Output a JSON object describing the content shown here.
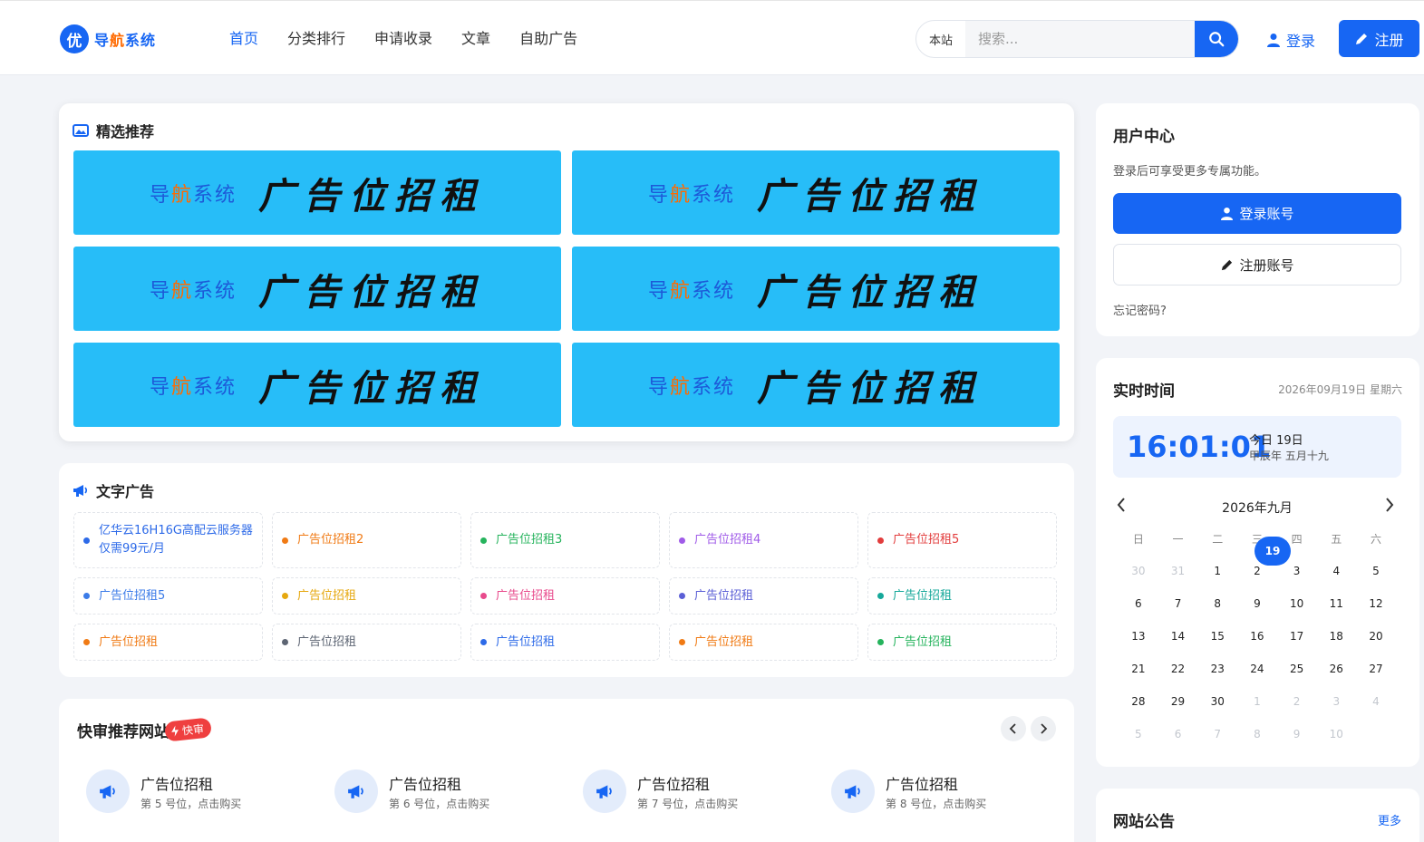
{
  "header": {
    "logo_badge": "优",
    "logo_text_a": "导",
    "logo_text_b": "航",
    "logo_text_c": "系统",
    "nav": [
      "首页",
      "分类排行",
      "申请收录",
      "文章",
      "自助广告"
    ],
    "search_scope": "本站",
    "search_placeholder": "搜索...",
    "login_label": "登录",
    "register_label": "注册"
  },
  "featured": {
    "title": "精选推荐",
    "banners": [
      {
        "brand_a": "导",
        "brand_b": "航",
        "brand_c": "系统",
        "main": "广告位招租"
      },
      {
        "brand_a": "导",
        "brand_b": "航",
        "brand_c": "系统",
        "main": "广告位招租"
      },
      {
        "brand_a": "导",
        "brand_b": "航",
        "brand_c": "系统",
        "main": "广告位招租"
      },
      {
        "brand_a": "导",
        "brand_b": "航",
        "brand_c": "系统",
        "main": "广告位招租"
      },
      {
        "brand_a": "导",
        "brand_b": "航",
        "brand_c": "系统",
        "main": "广告位招租"
      },
      {
        "brand_a": "导",
        "brand_b": "航",
        "brand_c": "系统",
        "main": "广告位招租"
      }
    ]
  },
  "text_ads": {
    "title": "文字广告",
    "items": [
      {
        "text": "亿华云16H16G高配云服务器仅需99元/月",
        "color": "#2d6ae8"
      },
      {
        "text": "广告位招租2",
        "color": "#f07a14"
      },
      {
        "text": "广告位招租3",
        "color": "#25b35c"
      },
      {
        "text": "广告位招租4",
        "color": "#a05be8"
      },
      {
        "text": "广告位招租5",
        "color": "#e23c3c"
      },
      {
        "text": "广告位招租5",
        "color": "#3b7be8"
      },
      {
        "text": "广告位招租",
        "color": "#e6a80f"
      },
      {
        "text": "广告位招租",
        "color": "#e84a8c"
      },
      {
        "text": "广告位招租",
        "color": "#5b5fd6"
      },
      {
        "text": "广告位招租",
        "color": "#16a89a"
      },
      {
        "text": "广告位招租",
        "color": "#f07a14"
      },
      {
        "text": "广告位招租",
        "color": "#5d6573"
      },
      {
        "text": "广告位招租",
        "color": "#2d6ae8"
      },
      {
        "text": "广告位招租",
        "color": "#f07a14"
      },
      {
        "text": "广告位招租",
        "color": "#25b35c"
      }
    ]
  },
  "quick": {
    "title": "快审推荐网站",
    "badge": "快审",
    "slots": [
      {
        "title": "广告位招租",
        "sub": "第 5 号位，点击购买"
      },
      {
        "title": "广告位招租",
        "sub": "第 6 号位，点击购买"
      },
      {
        "title": "广告位招租",
        "sub": "第 7 号位，点击购买"
      },
      {
        "title": "广告位招租",
        "sub": "第 8 号位，点击购买"
      }
    ]
  },
  "user_center": {
    "title": "用户中心",
    "desc": "登录后可享受更多专属功能。",
    "login_btn": "登录账号",
    "register_btn": "注册账号",
    "forgot": "忘记密码?"
  },
  "realtime": {
    "title": "实时时间",
    "date": "2026年09月19日 星期六",
    "clock": "16:01:01",
    "today": "今日 19日",
    "lunar": "甲辰年 五月十九",
    "month": "2026年九月",
    "weekdays": [
      "日",
      "一",
      "二",
      "三",
      "四",
      "五",
      "六"
    ],
    "days": [
      {
        "d": "30",
        "m": true
      },
      {
        "d": "31",
        "m": true
      },
      {
        "d": "1"
      },
      {
        "d": "2"
      },
      {
        "d": "3"
      },
      {
        "d": "4"
      },
      {
        "d": "5"
      },
      {
        "d": "6"
      },
      {
        "d": "7"
      },
      {
        "d": "8"
      },
      {
        "d": "9"
      },
      {
        "d": "10"
      },
      {
        "d": "11"
      },
      {
        "d": "12"
      },
      {
        "d": "13"
      },
      {
        "d": "14"
      },
      {
        "d": "15"
      },
      {
        "d": "16"
      },
      {
        "d": "17"
      },
      {
        "d": "18"
      },
      {
        "d": "19",
        "t": true
      },
      {
        "d": "20"
      },
      {
        "d": "21"
      },
      {
        "d": "22"
      },
      {
        "d": "23"
      },
      {
        "d": "24"
      },
      {
        "d": "25"
      },
      {
        "d": "26"
      },
      {
        "d": "27"
      },
      {
        "d": "28"
      },
      {
        "d": "29"
      },
      {
        "d": "30"
      },
      {
        "d": "1",
        "m": true
      },
      {
        "d": "2",
        "m": true
      },
      {
        "d": "3",
        "m": true
      },
      {
        "d": "4",
        "m": true
      },
      {
        "d": "5",
        "m": true
      },
      {
        "d": "6",
        "m": true
      },
      {
        "d": "7",
        "m": true
      },
      {
        "d": "8",
        "m": true
      },
      {
        "d": "9",
        "m": true
      },
      {
        "d": "10",
        "m": true
      }
    ]
  },
  "notice": {
    "title": "网站公告",
    "more": "更多"
  },
  "colors": {
    "accent": "#1766f3",
    "banner_bg": "#27bdf8",
    "badge_red": "#ef3f3f"
  }
}
